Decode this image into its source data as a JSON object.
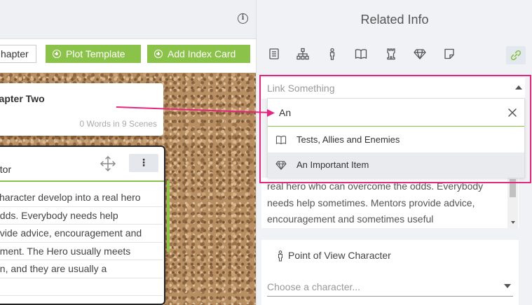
{
  "left": {
    "toolbar": {
      "chapter_button": "hapter",
      "plot_template_button": "Plot Template",
      "add_index_card_button": "Add Index Card"
    },
    "chapter_card": {
      "title": "hapter Two",
      "stats": "0 Words in 9 Scenes"
    },
    "scene_card": {
      "title": "ntor",
      "more_label": "⋮",
      "lines": [
        "character develop into a real hero",
        "odds. Everybody needs help",
        "ovide advice, encouragement and",
        "oment. The Hero usually meets",
        "on, and they are usually a"
      ]
    }
  },
  "right": {
    "header_title": "Related Info",
    "tabs": [
      "outline-icon",
      "hierarchy-icon",
      "character-icon",
      "book-icon",
      "tower-icon",
      "gem-icon",
      "note-icon",
      "link-icon"
    ],
    "link_select": {
      "placeholder": "Link Something",
      "search_value": "An",
      "options": [
        {
          "label": "Tests, Allies and Enemies",
          "icon": "book-icon"
        },
        {
          "label": "An Important Item",
          "icon": "gem-icon"
        }
      ]
    },
    "description_lines": [
      "real hero who can overcome the odds. Everybody",
      "needs help sometimes. Mentors provide advice,",
      "encouragement and sometimes useful"
    ],
    "pov": {
      "title": "Point of View Character",
      "placeholder": "Choose a character..."
    }
  },
  "colors": {
    "accent_green": "#8bc34a",
    "highlight_pink": "#e5267e",
    "panel_bg": "#f0f2f5"
  }
}
